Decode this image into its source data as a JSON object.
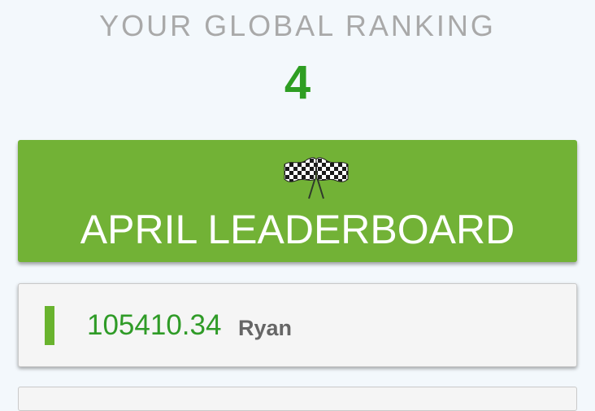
{
  "header": {
    "ranking_label": "YOUR GLOBAL RANKING",
    "ranking_value": "4"
  },
  "leaderboard": {
    "icon": "checkered-flags-icon",
    "title": "APRIL LEADERBOARD",
    "color": "#72b236"
  },
  "entries": [
    {
      "score": "105410.34",
      "name": "Ryan"
    }
  ],
  "colors": {
    "accent_green": "#2e9e22",
    "button_green": "#72b236",
    "label_gray": "#a9a9a9",
    "background": "#f3f8fc"
  }
}
